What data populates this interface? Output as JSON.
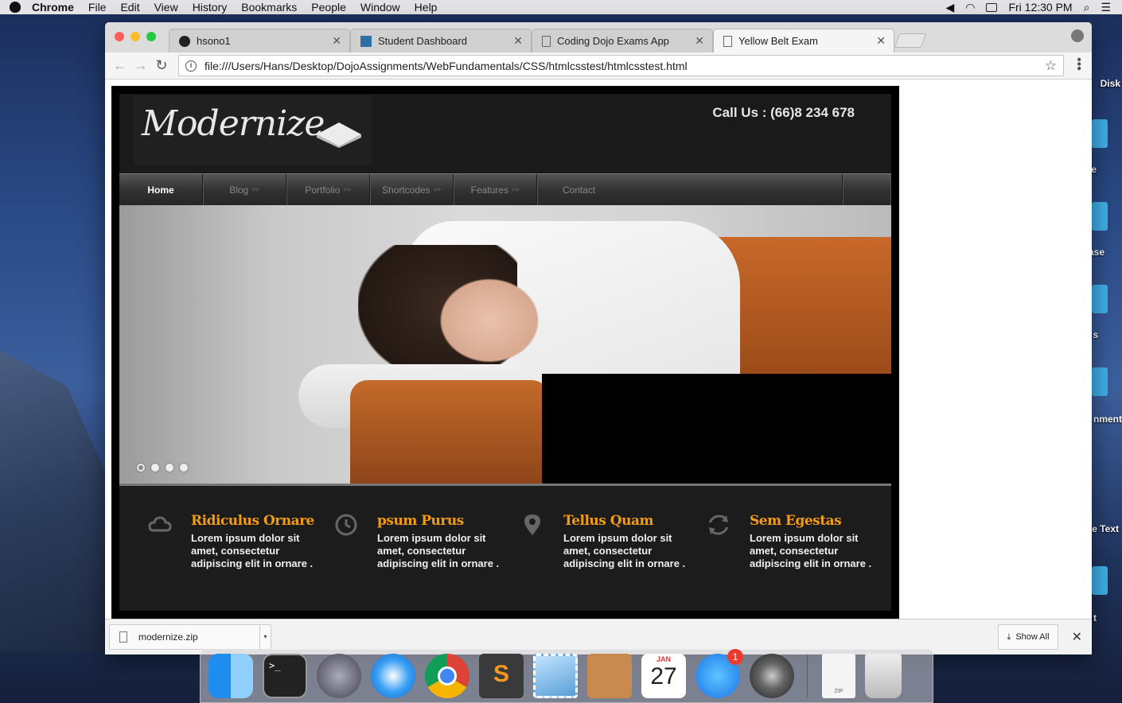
{
  "menubar": {
    "app_name": "Chrome",
    "menus": [
      "File",
      "Edit",
      "View",
      "History",
      "Bookmarks",
      "People",
      "Window",
      "Help"
    ],
    "clock": "Fri 12:30 PM"
  },
  "desktop_labels": [
    "Disk",
    "e",
    "ase",
    "s",
    "nment",
    "e Text",
    "t"
  ],
  "browser": {
    "tabs": [
      {
        "label": "hsono1",
        "icon": "github-icon"
      },
      {
        "label": "Student Dashboard",
        "icon": "dojo-icon"
      },
      {
        "label": "Coding Dojo Exams App",
        "icon": "page-icon"
      },
      {
        "label": "Yellow Belt Exam",
        "icon": "page-icon",
        "active": true
      }
    ],
    "url": "file:///Users/Hans/Desktop/DojoAssignments/WebFundamentals/CSS/htmlcsstest/htmlcsstest.html"
  },
  "site": {
    "logo": "Modernize",
    "call_us": "Call Us : (66)8 234 678",
    "nav": [
      {
        "label": "Home",
        "arrow": ""
      },
      {
        "label": "Blog",
        "arrow": ">>"
      },
      {
        "label": "Portfolio",
        "arrow": ">>"
      },
      {
        "label": "Shortcodes",
        "arrow": ">>"
      },
      {
        "label": "Features",
        "arrow": ">>"
      },
      {
        "label": "Contact",
        "arrow": ""
      }
    ],
    "features": [
      {
        "title": "Ridiculus Ornare",
        "text": "Lorem ipsum dolor sit amet, consectetur adipiscing elit in ornare .",
        "icon": "cloud-icon"
      },
      {
        "title": "psum Purus",
        "text": "Lorem ipsum dolor sit amet, consectetur adipiscing elit in ornare .",
        "icon": "clock-icon"
      },
      {
        "title": "Tellus Quam",
        "text": "Lorem ipsum dolor sit amet, consectetur adipiscing elit in ornare .",
        "icon": "map-pin-icon"
      },
      {
        "title": "Sem Egestas",
        "text": "Lorem ipsum dolor sit amet, consectetur adipiscing elit in ornare .",
        "icon": "refresh-icon"
      }
    ]
  },
  "downloads": {
    "file": "modernize.zip",
    "show_all": "Show All"
  },
  "dock": {
    "calendar_month": "JAN",
    "calendar_day": "27",
    "appstore_badge": "1",
    "zip_label": "ZIP"
  }
}
